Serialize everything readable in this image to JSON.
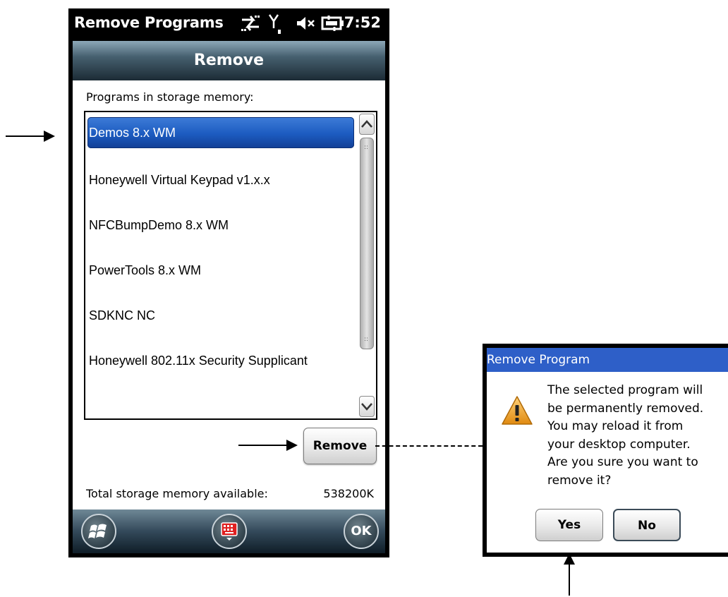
{
  "status_bar": {
    "title": "Remove Programs",
    "time": "7:52",
    "icons": [
      "sync-arrows-icon",
      "signal-icon",
      "speaker-muted-icon",
      "battery-charging-icon"
    ]
  },
  "header": {
    "title": "Remove"
  },
  "list": {
    "caption": "Programs in storage memory:",
    "items": [
      {
        "label": "Demos 8.x WM",
        "selected": true
      },
      {
        "label": "Honeywell Virtual Keypad v1.x.x",
        "selected": false
      },
      {
        "label": "NFCBumpDemo 8.x WM",
        "selected": false
      },
      {
        "label": "PowerTools 8.x WM",
        "selected": false
      },
      {
        "label": "SDKNC NC",
        "selected": false
      },
      {
        "label": "Honeywell 802.11x Security Supplicant",
        "selected": false
      }
    ]
  },
  "remove_button": {
    "label": "Remove"
  },
  "memory": {
    "label": "Total storage memory available:",
    "value": "538200K"
  },
  "softkeys": {
    "start_icon": "windows-start-icon",
    "keyboard_icon": "keyboard-icon",
    "ok_label": "OK"
  },
  "dialog": {
    "title": "Remove Program",
    "icon": "warning-icon",
    "message": "The selected program will\nbe permanently removed.\nYou may reload it from\nyour desktop computer.\nAre you sure you want to\nremove it?",
    "yes_label": "Yes",
    "no_label": "No"
  },
  "colors": {
    "selection": "#1c5bc0",
    "dialog_title": "#2e5fc8",
    "warning": "#f0a020"
  }
}
